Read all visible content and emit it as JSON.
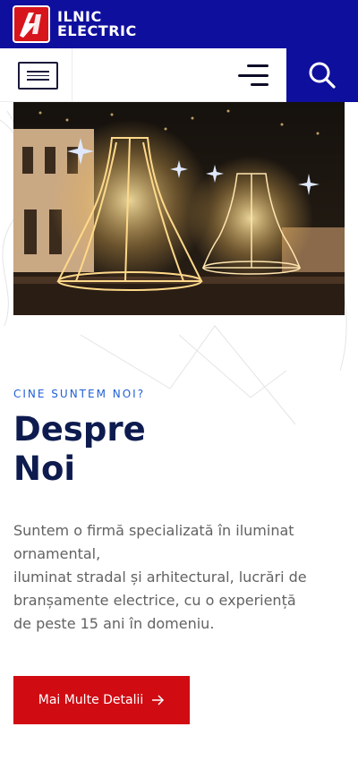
{
  "brand": {
    "line1": "ILNIC",
    "line2": "ELECTRIC"
  },
  "colors": {
    "primary_blue": "#0f0f9e",
    "accent_red": "#d10b12",
    "eyebrow_blue": "#1f5fd6",
    "title_navy": "#0d1b4f",
    "text_gray": "#626262"
  },
  "icons": {
    "menu": "hamburger-box-icon",
    "nav": "lines-menu-icon",
    "search": "search-icon",
    "cta_arrow": "arrow-right-icon"
  },
  "about": {
    "eyebrow": "CINE SUNTEM NOI?",
    "title_line1": "Despre",
    "title_line2": "Noi",
    "description_lines": [
      "Suntem o firmă specializată în iluminat",
      "ornamental,",
      "iluminat stradal și arhitectural, lucrări de",
      "branșamente electrice, cu o experiență",
      "de peste 15 ani în domeniu."
    ],
    "cta_label": "Mai Multe Detalii"
  }
}
